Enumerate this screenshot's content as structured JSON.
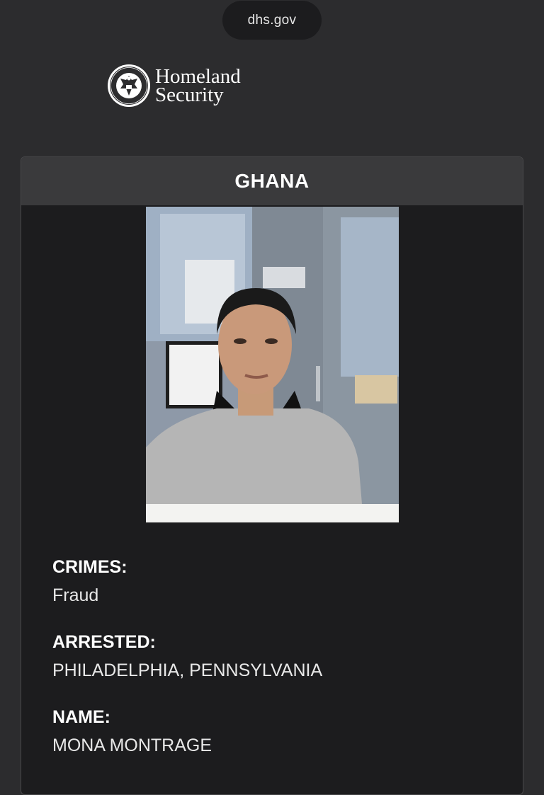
{
  "browser": {
    "url": "dhs.gov"
  },
  "header": {
    "logo_icon": "dhs-seal-icon",
    "logo_line1": "Homeland",
    "logo_line2": "Security"
  },
  "card": {
    "title": "GHANA",
    "photo": "mugshot-photo",
    "fields": [
      {
        "label": "CRIMES:",
        "value": "Fraud"
      },
      {
        "label": "ARRESTED:",
        "value": "PHILADELPHIA, PENNSYLVANIA"
      },
      {
        "label": "NAME:",
        "value": "MONA MONTRAGE"
      }
    ]
  }
}
